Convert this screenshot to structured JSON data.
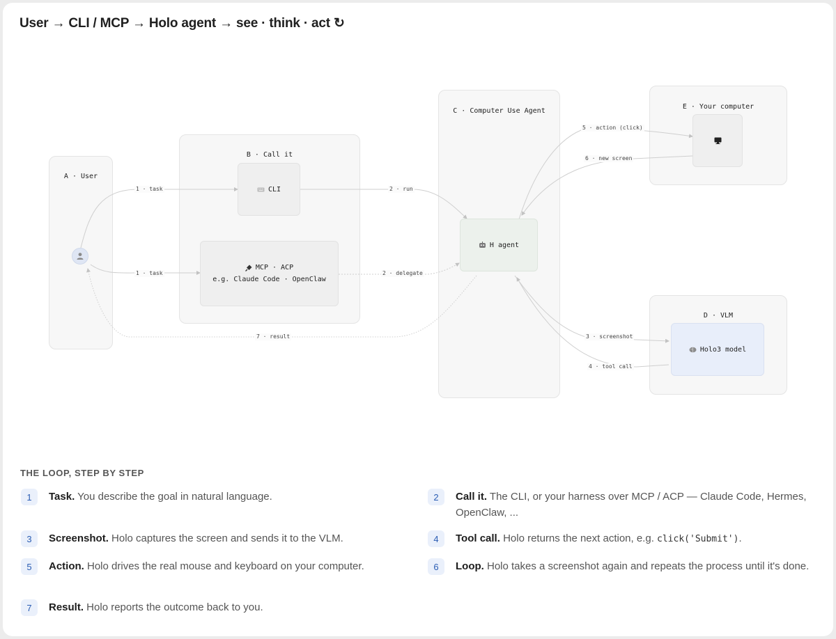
{
  "header": {
    "title": "User → CLI / MCP → Holo agent → see · think · act ↻"
  },
  "zones": {
    "user": "A · User",
    "call_it": "B · Call it",
    "agent": "C · Computer Use Agent",
    "vlm": "D · VLM",
    "computer": "E · Your computer"
  },
  "nodes": {
    "cli": "CLI",
    "mcp_line1": "MCP · ACP",
    "mcp_line2": "e.g. Claude Code · OpenClaw",
    "agent": "H agent",
    "vlm": "Holo3 model"
  },
  "icons": {
    "user": "user-icon",
    "cli": "keyboard-icon",
    "mcp": "plug-icon",
    "agent": "robot-icon",
    "vlm": "brain-icon",
    "computer": "monitor-icon"
  },
  "edges": {
    "task_cli": "1 · task",
    "task_mcp": "1 · task",
    "run": "2 · run",
    "delegate": "2 · delegate",
    "screenshot": "3 · screenshot",
    "tool_call": "4 · tool call",
    "action": "5 · action (click)",
    "new_screen": "6 · new screen",
    "result": "7 · result"
  },
  "loop": {
    "heading": "THE LOOP, STEP BY STEP",
    "steps": [
      {
        "num": "1",
        "title": "Task.",
        "text": " You describe the goal in natural language."
      },
      {
        "num": "2",
        "title": "Call it.",
        "text": " The CLI, or your harness over MCP / ACP — Claude Code, Hermes, OpenClaw, ..."
      },
      {
        "num": "3",
        "title": "Screenshot.",
        "text": " Holo captures the screen and sends it to the VLM."
      },
      {
        "num": "4",
        "title": "Tool call.",
        "text": " Holo returns the next action, e.g. ",
        "code": "click('Submit')",
        "after": "."
      },
      {
        "num": "5",
        "title": "Action.",
        "text": " Holo drives the real mouse and keyboard on your computer."
      },
      {
        "num": "6",
        "title": "Loop.",
        "text": " Holo takes a screenshot again and repeats the process until it's done."
      },
      {
        "num": "7",
        "title": "Result.",
        "text": " Holo reports the outcome back to you."
      }
    ]
  },
  "colors": {
    "edge": "#c9c9c9",
    "agent_fill": "#ecf1ec",
    "vlm_fill": "#e8eefa",
    "step_badge": "#eaf0fb",
    "step_badge_text": "#2b5db3"
  }
}
